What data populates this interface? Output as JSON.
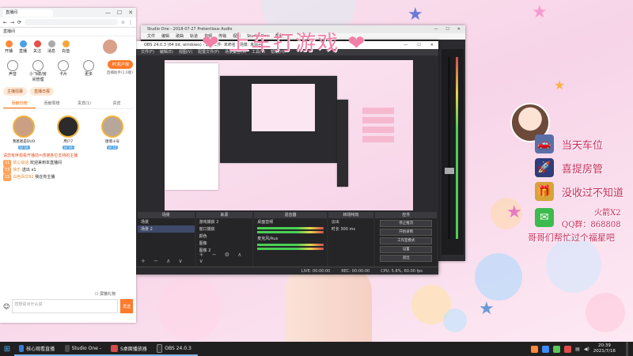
{
  "overlay": {
    "banner": "❤ 上车打游戏 ❤",
    "right_panel": {
      "rows": [
        {
          "icon": "car-icon",
          "text": "当天车位"
        },
        {
          "icon": "rocket-icon",
          "text": "喜提房管"
        },
        {
          "icon": "gift-box-icon",
          "text": "没收过不知道"
        }
      ],
      "wechat_line1": "火箭X2",
      "wechat_line2": "QQ群：868808",
      "bottom_text": "哥哥们帮忙过个福星吧"
    }
  },
  "browser": {
    "tab_title": "直播间",
    "tab_strip": "直播间",
    "top_icons": [
      "开播",
      "直播",
      "关注",
      "消息",
      "充值"
    ],
    "tools": [
      "声音",
      "小飞碟/房间管理",
      "卡片",
      "更多"
    ],
    "pc_button": "PC机户端",
    "pc_sub": "直播助手(1.0版)",
    "sub_tabs": [
      "主播招募",
      "直播日报"
    ],
    "rank_tabs": [
      "贡献日榜",
      "贡献周榜",
      "贵宾(1)",
      "贵宾"
    ],
    "ranks": [
      {
        "name": "我爸爸是DUO",
        "lv": "LV 18"
      },
      {
        "name": "用户7",
        "lv": "LV 16"
      },
      {
        "name": "唐僧十号",
        "lv": "LV 15"
      }
    ],
    "chat": [
      {
        "sys": "请您有序观看开播前=感谢各位支持的主播"
      },
      {
        "badge": "11",
        "name": "钦心说话",
        "text": "欢迎来到本直播间"
      },
      {
        "badge": "Y3",
        "name": "快乐",
        "text": "送出 x1"
      },
      {
        "badge": "15",
        "name": "白色风华92",
        "text": "我在你主播"
      }
    ],
    "input_placeholder": "您想说点什么说",
    "send_label": "发送",
    "checkbox_label": "屏蔽礼物"
  },
  "studio": {
    "title": "Studio One - 2018-07-27 Pretentious Audio",
    "menu": [
      "文件",
      "编辑",
      "歌曲",
      "轨道",
      "音频",
      "传输",
      "视图",
      "Studio One",
      "帮助"
    ]
  },
  "obs": {
    "title": "OBS 24.0.3 (64 bit, windows) - 配置文件: 未命名 - 场景: 未命名",
    "menu": [
      "文件(F)",
      "编辑(E)",
      "视图(V)",
      "配置文件(P)",
      "场景集合(S)",
      "工具(T)",
      "帮助(H)"
    ],
    "docks": {
      "scenes": {
        "header": "场景",
        "items": [
          "场景",
          "场景 2"
        ]
      },
      "sources": {
        "header": "来源",
        "items": [
          "游戏捕获 2",
          "窗口捕获",
          "颜色",
          "图像",
          "图像 2"
        ]
      },
      "mixer": {
        "header": "混音器",
        "tracks": [
          "桌面音频",
          "麦克风/Aux"
        ]
      },
      "transitions": {
        "header": "转场特效",
        "fade": "淡出",
        "duration_label": "时长",
        "duration_value": "300 ms"
      },
      "controls": {
        "header": "控件",
        "buttons": [
          "停止推流",
          "开始录制",
          "工作室模式",
          "设置",
          "退出"
        ]
      }
    },
    "status": {
      "live": "LIVE: 00:00:00",
      "rec": "REC: 00:00:00",
      "cpu": "CPU: 5.8%, 60.00 fps"
    }
  },
  "taskbar": {
    "apps": [
      {
        "label": "核心观看直播 - 游戏",
        "color": "#3a7bd5"
      },
      {
        "label": "Studio One - 2018...",
        "color": "#4b4b4b"
      },
      {
        "label": "S桌面播放器",
        "color": "#d54b4b"
      },
      {
        "label": "OBS 24.0.3 (64 bit...",
        "color": "#333333"
      }
    ],
    "time": "20:39",
    "date": "2021/7/16"
  }
}
